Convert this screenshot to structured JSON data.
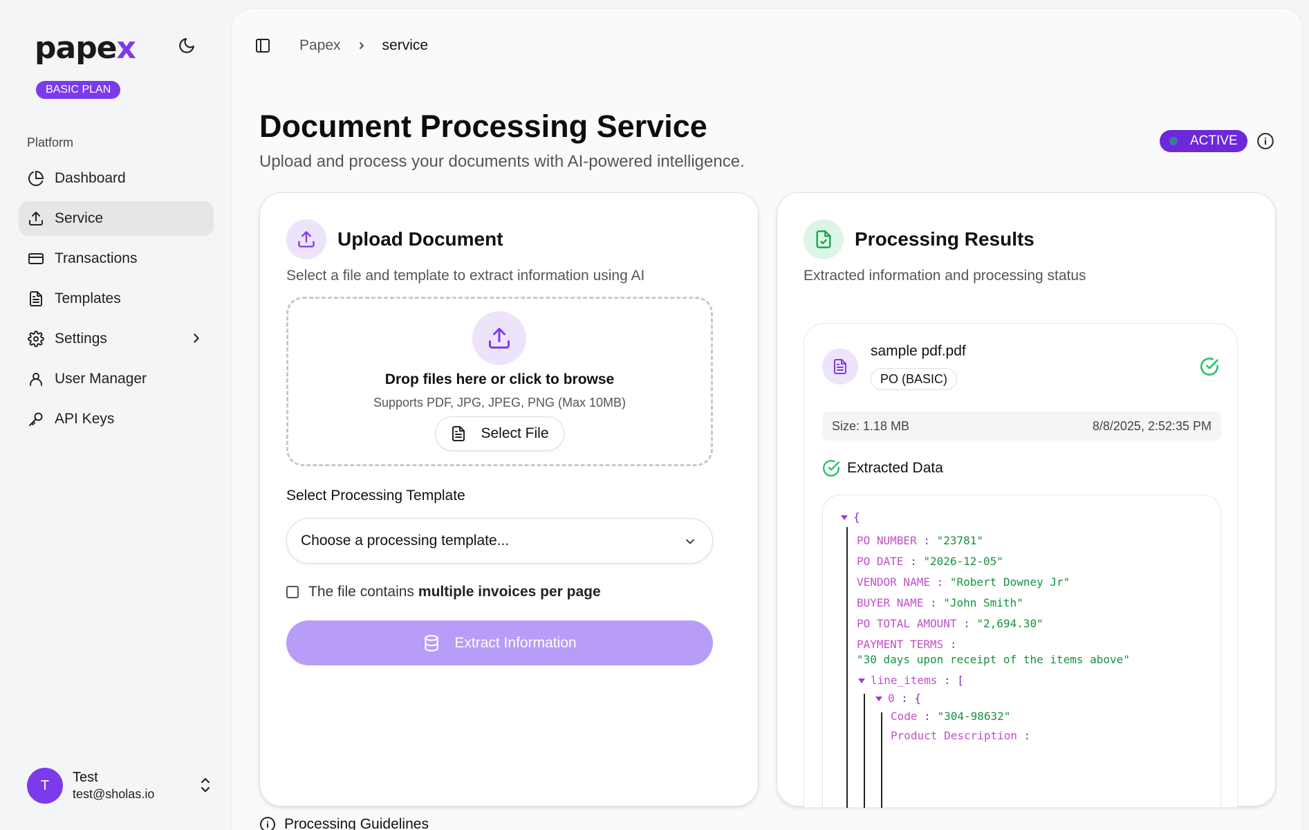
{
  "brand": {
    "logo_main": "pape",
    "logo_x": "x",
    "plan_badge": "BASIC PLAN"
  },
  "sidebar": {
    "section_label": "Platform",
    "items": [
      {
        "label": "Dashboard",
        "icon": "pie-chart-icon"
      },
      {
        "label": "Service",
        "icon": "upload-icon",
        "active": true
      },
      {
        "label": "Transactions",
        "icon": "credit-card-icon"
      },
      {
        "label": "Templates",
        "icon": "file-text-icon"
      },
      {
        "label": "Settings",
        "icon": "gear-icon"
      },
      {
        "label": "User Manager",
        "icon": "user-icon"
      },
      {
        "label": "API Keys",
        "icon": "key-icon"
      }
    ],
    "user": {
      "initial": "T",
      "name": "Test",
      "email": "test@sholas.io"
    }
  },
  "breadcrumb": {
    "root": "Papex",
    "current": "service"
  },
  "header": {
    "title": "Document Processing Service",
    "subtitle": "Upload and process your documents with AI-powered intelligence.",
    "status": "ACTIVE"
  },
  "upload": {
    "title": "Upload Document",
    "subtitle": "Select a file and template to extract information using AI",
    "drop_title": "Drop files here or click to browse",
    "drop_sub": "Supports PDF, JPG, JPEG, PNG (Max 10MB)",
    "select_file": "Select File",
    "template_label": "Select Processing Template",
    "template_placeholder": "Choose a processing template...",
    "multi_prefix": "The file contains",
    "multi_bold": "multiple invoices per page",
    "extract_button": "Extract Information"
  },
  "results": {
    "title": "Processing Results",
    "subtitle": "Extracted information and processing status",
    "file_name": "sample pdf.pdf",
    "file_tag": "PO (BASIC)",
    "size": "Size: 1.18 MB",
    "timestamp": "8/8/2025, 2:52:35 PM",
    "extracted_label": "Extracted Data",
    "json": {
      "open_brace": "{",
      "po_number_key": "PO NUMBER",
      "po_number_val": "\"23781\"",
      "po_date_key": "PO DATE",
      "po_date_val": "\"2026-12-05\"",
      "vendor_key": "VENDOR NAME",
      "vendor_val": "\"Robert Downey Jr\"",
      "buyer_key": "BUYER NAME",
      "buyer_val": "\"John Smith\"",
      "total_key": "PO TOTAL AMOUNT",
      "total_val": "\"2,694.30\"",
      "terms_key": "PAYMENT TERMS",
      "terms_val": "\"30 days upon receipt of the items above\"",
      "line_items_key": "line_items",
      "open_bracket": "[",
      "index_key": "0",
      "code_key": "Code",
      "code_val": "\"304-98632\"",
      "desc_key": "Product Description"
    }
  },
  "footer": {
    "guidelines": "Processing Guidelines"
  },
  "colors": {
    "accent": "#7c3aed",
    "success": "#22c55e",
    "button_disabled": "#b79cf8"
  }
}
